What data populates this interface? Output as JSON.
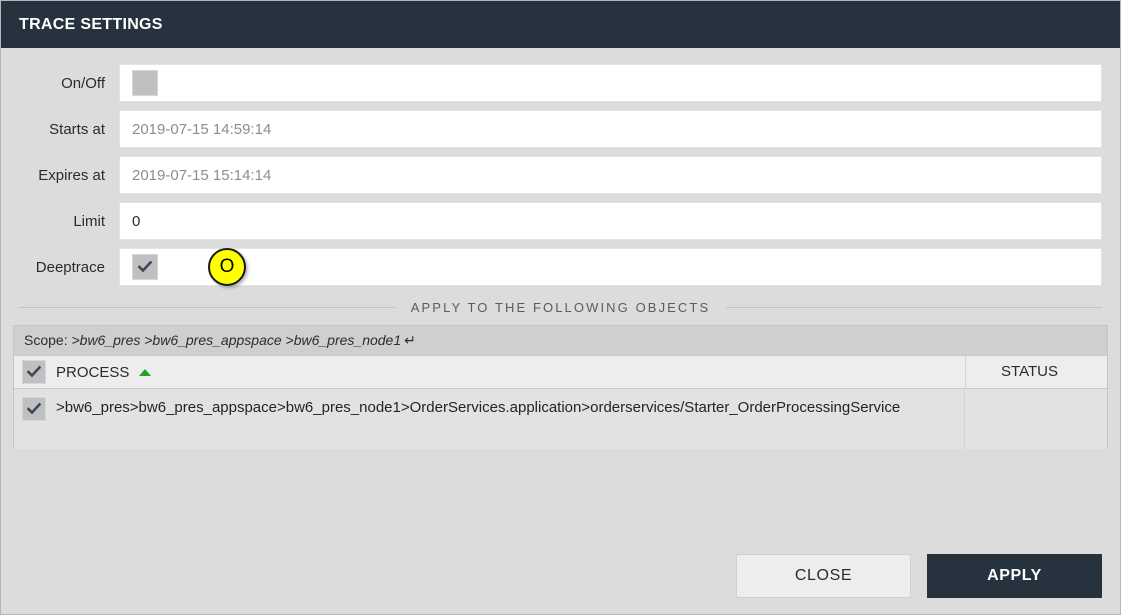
{
  "window": {
    "title": "TRACE SETTINGS"
  },
  "form": {
    "rows": [
      {
        "label": "On/Off",
        "type": "checkbox",
        "checked": false
      },
      {
        "label": "Starts at",
        "type": "text",
        "value": "2019-07-15 14:59:14",
        "muted": true
      },
      {
        "label": "Expires at",
        "type": "text",
        "value": "2019-07-15 15:14:14",
        "muted": true
      },
      {
        "label": "Limit",
        "type": "text",
        "value": "0",
        "muted": false
      },
      {
        "label": "Deeptrace",
        "type": "checkbox",
        "checked": true
      }
    ]
  },
  "annotation": {
    "badge_label": "O",
    "badge_color": "#ffff00",
    "badge_border_color": "#1a1a1a"
  },
  "section": {
    "divider_label": "APPLY TO THE FOLLOWING OBJECTS"
  },
  "scope": {
    "label": "Scope:",
    "path": ">bw6_pres >bw6_pres_appspace >bw6_pres_node1",
    "return_icon": "↵"
  },
  "table": {
    "header": {
      "select_all_checked": true,
      "process_column": "PROCESS",
      "sort_direction": "ascending",
      "sort_color": "#22a322",
      "status_column": "STATUS"
    },
    "rows": [
      {
        "checked": true,
        "path": ">bw6_pres>bw6_pres_appspace>bw6_pres_node1>OrderServices.application>orderservices/Starter_OrderProcessingService",
        "status": ""
      }
    ]
  },
  "footer": {
    "close_label": "CLOSE",
    "apply_label": "APPLY"
  },
  "theme": {
    "header_bg": "#26333f",
    "page_bg": "#dcdcdc",
    "primary_button_bg": "#26333f"
  }
}
